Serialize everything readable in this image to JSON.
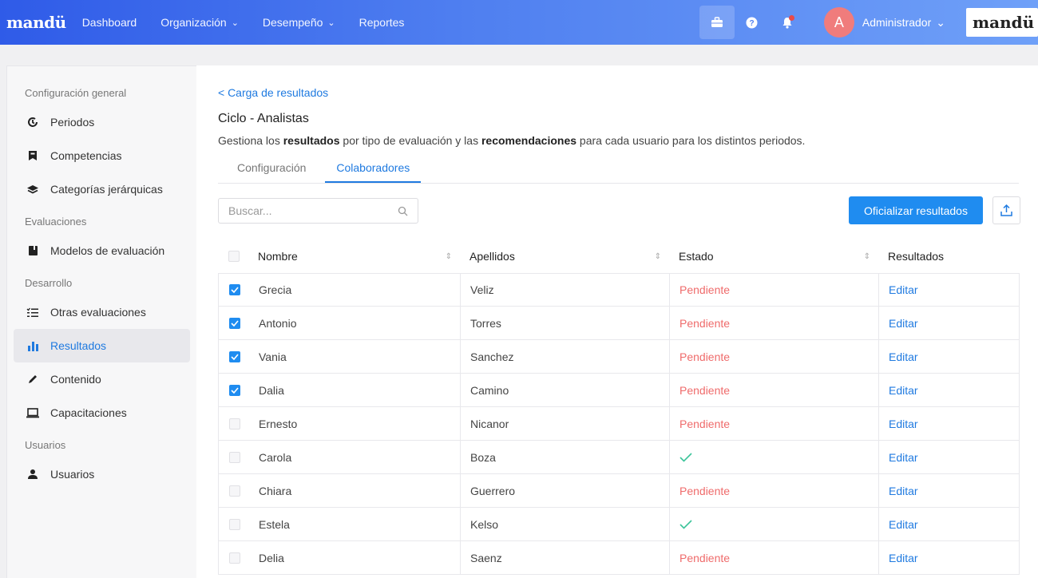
{
  "topbar": {
    "logo": "mandü",
    "nav": [
      {
        "label": "Dashboard",
        "dropdown": false
      },
      {
        "label": "Organización",
        "dropdown": true
      },
      {
        "label": "Desempeño",
        "dropdown": true
      },
      {
        "label": "Reportes",
        "dropdown": false
      }
    ],
    "notification_count": "1",
    "avatar_letter": "A",
    "user_name": "Administrador",
    "brand_box": "mandü"
  },
  "sidebar": {
    "sections": [
      {
        "title": "Configuración general",
        "items": [
          {
            "label": "Periodos",
            "icon": "clock-icon"
          },
          {
            "label": "Competencias",
            "icon": "bookmark-icon"
          },
          {
            "label": "Categorías jerárquicas",
            "icon": "layers-icon"
          }
        ]
      },
      {
        "title": "Evaluaciones",
        "items": [
          {
            "label": "Modelos de evaluación",
            "icon": "book-icon"
          }
        ]
      },
      {
        "title": "Desarrollo",
        "items": [
          {
            "label": "Otras evaluaciones",
            "icon": "checklist-icon"
          },
          {
            "label": "Resultados",
            "icon": "bar-chart-icon",
            "active": true
          },
          {
            "label": "Contenido",
            "icon": "pencil-icon"
          },
          {
            "label": "Capacitaciones",
            "icon": "laptop-icon"
          }
        ]
      },
      {
        "title": "Usuarios",
        "items": [
          {
            "label": "Usuarios",
            "icon": "user-icon"
          }
        ]
      }
    ]
  },
  "main": {
    "back_link": "< Carga de resultados",
    "title": "Ciclo - Analistas",
    "description": {
      "p1": "Gestiona los ",
      "b1": "resultados",
      "p2": " por tipo de evaluación y las ",
      "b2": "recomendaciones",
      "p3": " para cada usuario para los distintos periodos."
    },
    "tabs": [
      {
        "label": "Configuración",
        "active": false
      },
      {
        "label": "Colaboradores",
        "active": true
      }
    ],
    "search_placeholder": "Buscar...",
    "primary_button": "Oficializar resultados",
    "table": {
      "headers": {
        "nombre": "Nombre",
        "apellidos": "Apellidos",
        "estado": "Estado",
        "resultados": "Resultados"
      },
      "rows": [
        {
          "checked": true,
          "nombre": "Grecia",
          "apellidos": "Veliz",
          "estado": "Pendiente",
          "done": false,
          "accion": "Editar"
        },
        {
          "checked": true,
          "nombre": "Antonio",
          "apellidos": "Torres",
          "estado": "Pendiente",
          "done": false,
          "accion": "Editar"
        },
        {
          "checked": true,
          "nombre": "Vania",
          "apellidos": "Sanchez",
          "estado": "Pendiente",
          "done": false,
          "accion": "Editar"
        },
        {
          "checked": true,
          "nombre": "Dalia",
          "apellidos": "Camino",
          "estado": "Pendiente",
          "done": false,
          "accion": "Editar"
        },
        {
          "checked": false,
          "nombre": "Ernesto",
          "apellidos": "Nicanor",
          "estado": "Pendiente",
          "done": false,
          "accion": "Editar"
        },
        {
          "checked": false,
          "nombre": "Carola",
          "apellidos": "Boza",
          "estado": "",
          "done": true,
          "accion": "Editar"
        },
        {
          "checked": false,
          "nombre": "Chiara",
          "apellidos": "Guerrero",
          "estado": "Pendiente",
          "done": false,
          "accion": "Editar"
        },
        {
          "checked": false,
          "nombre": "Estela",
          "apellidos": "Kelso",
          "estado": "",
          "done": true,
          "accion": "Editar"
        },
        {
          "checked": false,
          "nombre": "Delia",
          "apellidos": "Saenz",
          "estado": "Pendiente",
          "done": false,
          "accion": "Editar"
        }
      ]
    }
  },
  "colors": {
    "accent": "#1f7ae0",
    "pending": "#ef6b6b",
    "done": "#3cc49a"
  }
}
